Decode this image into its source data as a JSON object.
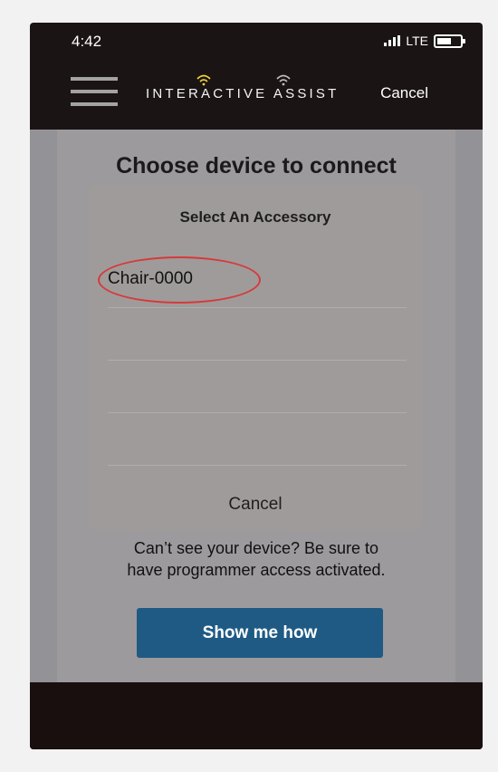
{
  "status": {
    "time": "4:42",
    "network": "LTE"
  },
  "nav": {
    "brand": "INTERACTIVE ASSIST",
    "cancel_label": "Cancel"
  },
  "main": {
    "title": "Choose device to connect",
    "sheet": {
      "title": "Select An Accessory",
      "devices": [
        "Chair-0000"
      ],
      "cancel_label": "Cancel"
    },
    "help_text_1": "Can’t see your device? Be sure to",
    "help_text_2": "have programmer access activated.",
    "help_button": "Show me how"
  },
  "colors": {
    "nav_bg": "#1b1414",
    "content_bg": "#939397",
    "sheet_bg": "#a09b9b",
    "button_bg": "#1f5a84",
    "highlight": "#d63a3a",
    "brand_accent": "#f3d23a"
  },
  "icons": [
    "signal-icon",
    "battery-icon",
    "hamburger-icon",
    "wave-icon"
  ]
}
